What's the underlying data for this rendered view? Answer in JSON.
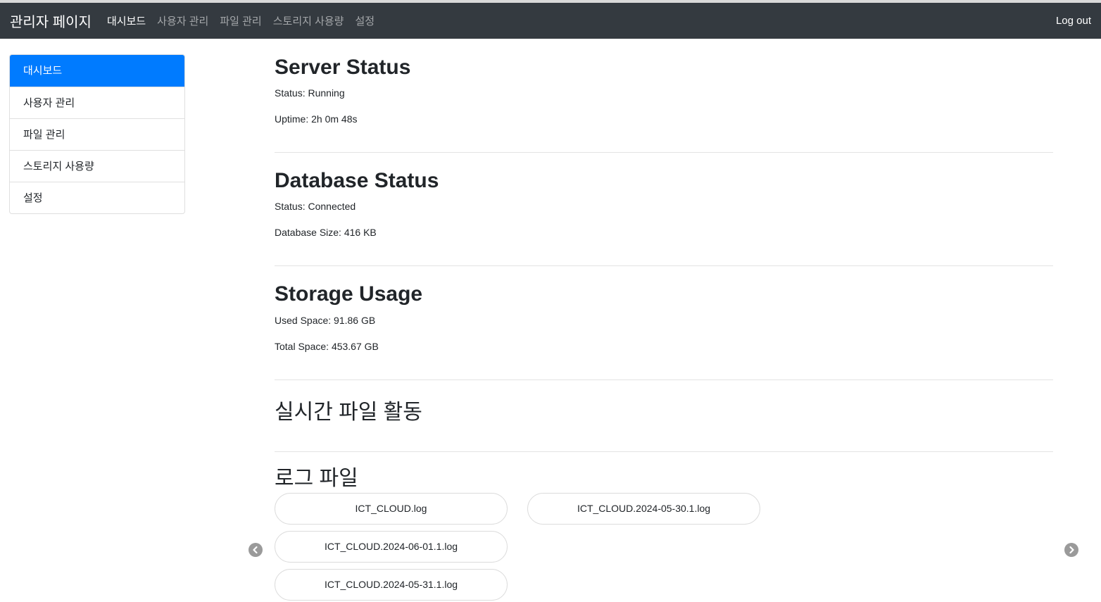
{
  "navbar": {
    "brand": "관리자 페이지",
    "links": [
      "대시보드",
      "사용자 관리",
      "파일 관리",
      "스토리지 사용량",
      "설정"
    ],
    "logout": "Log out"
  },
  "sidebar": {
    "items": [
      "대시보드",
      "사용자 관리",
      "파일 관리",
      "스토리지 사용량",
      "설정"
    ]
  },
  "server": {
    "title": "Server Status",
    "status": "Status: Running",
    "uptime": "Uptime: 2h 0m 48s"
  },
  "database": {
    "title": "Database Status",
    "status": "Status: Connected",
    "size": "Database Size: 416 KB"
  },
  "storage": {
    "title": "Storage Usage",
    "used": "Used Space: 91.86 GB",
    "total": "Total Space: 453.67 GB"
  },
  "activity": {
    "title": "실시간 파일 활동"
  },
  "logs": {
    "title": "로그 파일",
    "files": [
      "ICT_CLOUD.log",
      "ICT_CLOUD.2024-05-30.1.log",
      "ICT_CLOUD.2024-06-01.1.log",
      "ICT_CLOUD.2024-05-31.1.log"
    ]
  },
  "icons": {
    "prev": "chevron-left-icon",
    "next": "chevron-right-icon"
  }
}
